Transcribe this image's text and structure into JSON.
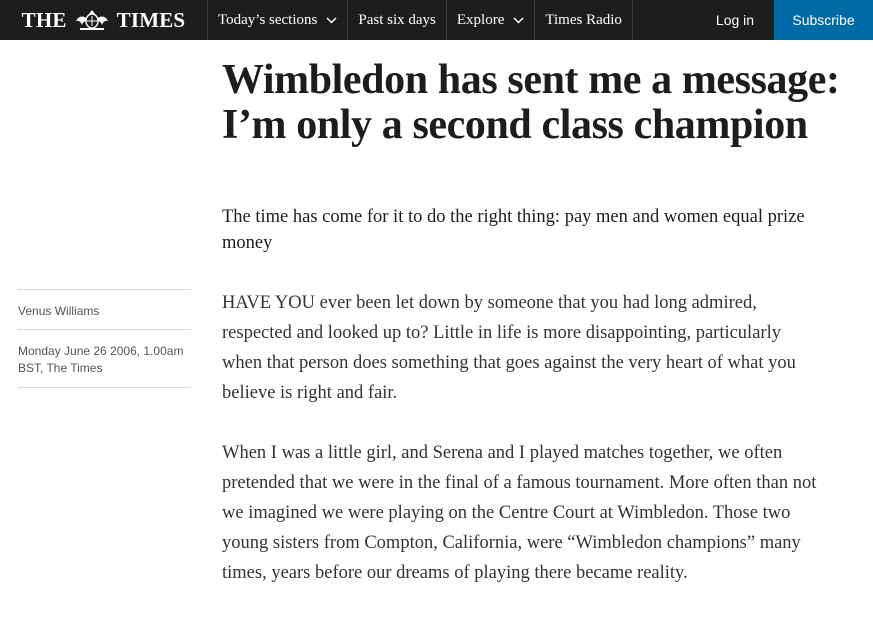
{
  "header": {
    "logo_left": "THE",
    "logo_right": "TIMES",
    "nav": [
      {
        "label": "Today’s sections",
        "has_dropdown": true
      },
      {
        "label": "Past six days",
        "has_dropdown": false
      },
      {
        "label": "Explore",
        "has_dropdown": true
      },
      {
        "label": "Times Radio",
        "has_dropdown": false
      }
    ],
    "login_label": "Log in",
    "subscribe_label": "Subscribe",
    "colors": {
      "bar": "#1d1d1b",
      "subscribe": "#006aa7"
    }
  },
  "article": {
    "headline": "Wimbledon has sent me a message: I’m only a second class champion",
    "standfirst": "The time has come for it to do the right thing: pay men and women equal prize money",
    "author": "Venus Williams",
    "dateline": "Monday June 26 2006, 1.00am BST, The Times",
    "paragraphs": [
      "HAVE YOU ever been let down by someone that you had long admired, respected and looked up to? Little in life is more disappointing, particularly when that person does something that goes against the very heart of what you believe is right and fair.",
      "When I was a little girl, and Serena and I played matches together, we often pretended that we were in the final of a famous tournament. More often than not we imagined we were playing on the Centre Court at Wimbledon. Those two young sisters from Compton, California, were “Wimbledon champions” many times, years before our dreams of playing there became reality."
    ]
  }
}
